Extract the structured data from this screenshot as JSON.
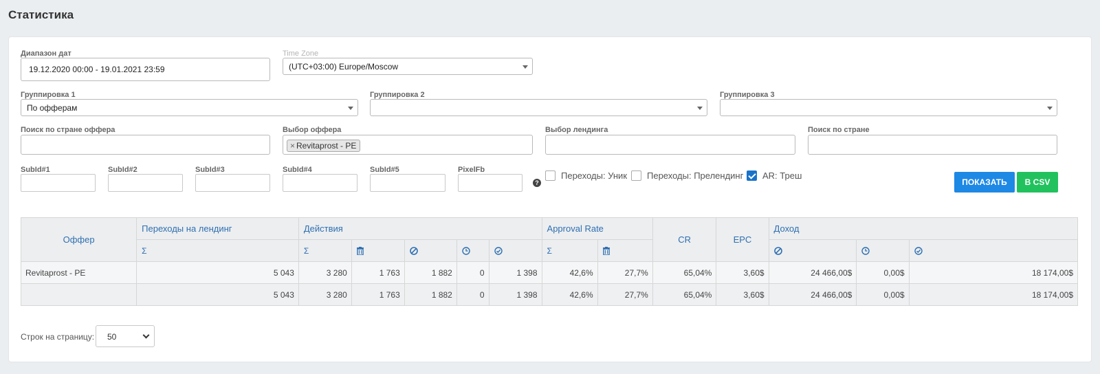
{
  "page_title": "Статистика",
  "filters": {
    "date_range": {
      "label": "Диапазон дат",
      "value": "19.12.2020 00:00 - 19.01.2021 23:59"
    },
    "timezone": {
      "label": "Time Zone",
      "value": "(UTC+03:00) Europe/Moscow"
    },
    "group1": {
      "label": "Группировка 1",
      "value": "По офферам"
    },
    "group2": {
      "label": "Группировка 2",
      "value": ""
    },
    "group3": {
      "label": "Группировка 3",
      "value": ""
    },
    "offer_country": {
      "label": "Поиск по стране оффера",
      "value": ""
    },
    "offer_select": {
      "label": "Выбор оффера",
      "tag": "Revitaprost - PE",
      "tag_remove": "×"
    },
    "landing_select": {
      "label": "Выбор лендинга",
      "value": ""
    },
    "country_search": {
      "label": "Поиск по стране",
      "value": ""
    },
    "subids": [
      {
        "label": "SubId#1",
        "value": ""
      },
      {
        "label": "SubId#2",
        "value": ""
      },
      {
        "label": "SubId#3",
        "value": ""
      },
      {
        "label": "SubId#4",
        "value": ""
      },
      {
        "label": "SubId#5",
        "value": ""
      },
      {
        "label": "PixelFb",
        "value": ""
      }
    ],
    "help_icon": "?",
    "checkboxes": [
      {
        "label": "Переходы: Уник",
        "checked": false
      },
      {
        "label": "Переходы: Прелендинг",
        "checked": false
      },
      {
        "label": "AR: Треш",
        "checked": true
      }
    ],
    "show_button": "ПОКАЗАТЬ",
    "csv_button": "В CSV"
  },
  "table": {
    "headers": {
      "offer": "Оффер",
      "landing_clicks": "Переходы на лендинг",
      "actions": "Действия",
      "approval_rate": "Approval Rate",
      "cr": "CR",
      "epc": "EPC",
      "income": "Доход"
    },
    "sigma": "Σ",
    "rows": [
      {
        "offer": "Revitaprost - PE",
        "cells": [
          "5 043",
          "3 280",
          "1 763",
          "1 882",
          "0",
          "1 398",
          "42,6%",
          "27,7%",
          "65,04%",
          "3,60$",
          "24 466,00$",
          "0,00$",
          "18 174,00$"
        ]
      }
    ],
    "total": {
      "offer": "",
      "cells": [
        "5 043",
        "3 280",
        "1 763",
        "1 882",
        "0",
        "1 398",
        "42,6%",
        "27,7%",
        "65,04%",
        "3,60$",
        "24 466,00$",
        "0,00$",
        "18 174,00$"
      ]
    }
  },
  "pagination": {
    "label": "Строк на страницу:",
    "value": "50"
  },
  "colors": {
    "accent": "#1e88e5",
    "csv": "#21c25e",
    "header_text": "#2f6fb0"
  }
}
